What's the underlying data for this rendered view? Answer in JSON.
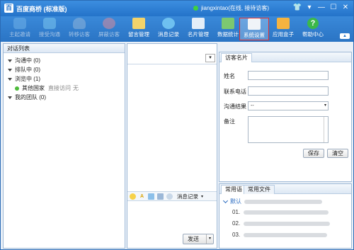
{
  "titlebar": {
    "logo": "百",
    "app_title": "百度商桥 (标准版)",
    "user_status": "jiangxintao(在线, 接待访客)",
    "btn_shirt": "👕",
    "btn_menu": "▾",
    "btn_minimize": "—",
    "btn_maximize": "☐",
    "btn_close": "✕"
  },
  "toolbar": {
    "items": [
      {
        "label": "主起邀请",
        "icon": "chat-bubble-icon",
        "color": "#6fb0e8"
      },
      {
        "label": "接受沟通",
        "icon": "chat-accept-icon",
        "color": "#7bc6ee"
      },
      {
        "label": "转移访客",
        "icon": "transfer-user-icon",
        "color": "#8fb5d8"
      },
      {
        "label": "屏蔽访客",
        "icon": "block-icon",
        "color": "#d98a9a"
      },
      {
        "label": "留言管理",
        "icon": "envelope-icon",
        "color": "#f3d36a"
      },
      {
        "label": "消息记录",
        "icon": "clock-icon",
        "color": "#6ec0f0"
      },
      {
        "label": "名片管理",
        "icon": "card-icon",
        "color": "#e4eef8"
      },
      {
        "label": "数据统计",
        "icon": "chart-icon",
        "color": "#7cc870"
      },
      {
        "label": "系统设置",
        "icon": "settings-icon",
        "color": "#f0f4f8"
      },
      {
        "label": "应用盒子",
        "icon": "apps-grid-icon",
        "color": "#f4b340"
      },
      {
        "label": "帮助中心",
        "icon": "help-icon",
        "color": "#3bb84a"
      }
    ]
  },
  "left_panel": {
    "header": "对话列表",
    "groups": [
      {
        "label": "沟通中 (0)"
      },
      {
        "label": "排队中 (0)"
      },
      {
        "label": "浏览中 (1)"
      }
    ],
    "visitor": {
      "name": "其他国家",
      "source": "直接访问",
      "note": "无"
    },
    "team": {
      "label": "我的团队 (0)"
    }
  },
  "center": {
    "history_label": "消息记录",
    "send_label": "发送"
  },
  "visitor_card": {
    "tab": "访客名片",
    "name_label": "姓名",
    "phone_label": "联系电话",
    "result_label": "沟通结果",
    "result_value": "--",
    "note_label": "备注",
    "save": "保存",
    "clear": "清空"
  },
  "phrases": {
    "tab_common": "常用语",
    "tab_files": "常用文件",
    "group": "默认",
    "items": [
      {
        "num": "01."
      },
      {
        "num": "02."
      },
      {
        "num": "03."
      }
    ]
  }
}
